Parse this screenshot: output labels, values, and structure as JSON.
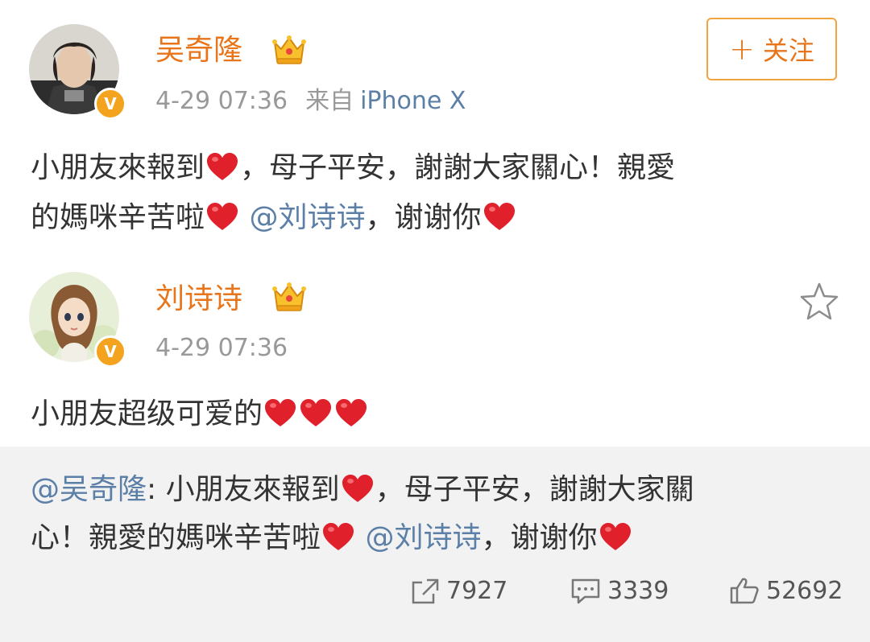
{
  "post": {
    "author": "吴奇隆",
    "verified_badge": "V",
    "time": "4-29 07:36",
    "source_label": "来自",
    "device": "iPhone X",
    "follow_label": "关注",
    "content": {
      "line1_a": "小朋友來報到",
      "line1_b": "，母子平安，謝謝大家關心！親愛",
      "line2_a": "的媽咪辛苦啦",
      "mention": "@刘诗诗",
      "line2_b": "，谢谢你"
    }
  },
  "reply": {
    "author": "刘诗诗",
    "verified_badge": "V",
    "time": "4-29 07:36",
    "text": "小朋友超级可爱的"
  },
  "repost": {
    "mention": "@吴奇隆",
    "line1": ": 小朋友來報到",
    "line1_b": "，母子平安，謝謝大家關",
    "line2_a": "心！親愛的媽咪辛苦啦",
    "mention2": "@刘诗诗",
    "line2_b": "，谢谢你"
  },
  "stats": {
    "reposts": "7927",
    "comments": "3339",
    "likes": "52692"
  },
  "icons": {
    "heart": "heart-icon",
    "crown": "crown-icon",
    "star": "star-icon",
    "share": "share-icon",
    "comment": "comment-icon",
    "like": "thumbs-up-icon"
  },
  "colors": {
    "username": "#e8751a",
    "link": "#5b7fa6",
    "badge": "#f4a31e",
    "heart": "#e0202a",
    "repost_bg": "#f2f2f2"
  }
}
